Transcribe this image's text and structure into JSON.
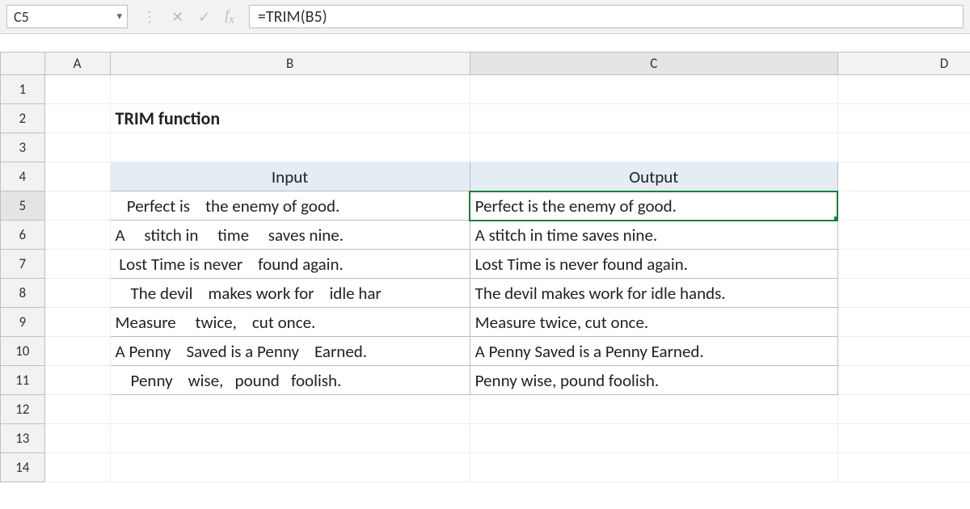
{
  "nameBox": "C5",
  "formulaBar": "=TRIM(B5)",
  "columns": [
    "A",
    "B",
    "C",
    "D"
  ],
  "rowNumbers": [
    "1",
    "2",
    "3",
    "4",
    "5",
    "6",
    "7",
    "8",
    "9",
    "10",
    "11",
    "12",
    "13",
    "14"
  ],
  "title": "TRIM function",
  "tableHeaders": {
    "input": "Input",
    "output": "Output"
  },
  "rows": [
    {
      "input": "   Perfect is    the enemy of good.",
      "output": "Perfect is the enemy of good."
    },
    {
      "input": "A     stitch in     time     saves nine.",
      "output": "A stitch in time saves nine."
    },
    {
      "input": " Lost Time is never    found again.",
      "output": "Lost Time is never found again."
    },
    {
      "input": "    The devil    makes work for    idle har",
      "output": "The devil makes work for idle hands."
    },
    {
      "input": "Measure     twice,    cut once.",
      "output": "Measure twice, cut once."
    },
    {
      "input": "A Penny    Saved is a Penny    Earned.",
      "output": "A Penny Saved is a Penny Earned."
    },
    {
      "input": "    Penny    wise,   pound   foolish.",
      "output": "Penny wise, pound foolish."
    }
  ],
  "selectedColumn": "C",
  "selectedRow": "5"
}
